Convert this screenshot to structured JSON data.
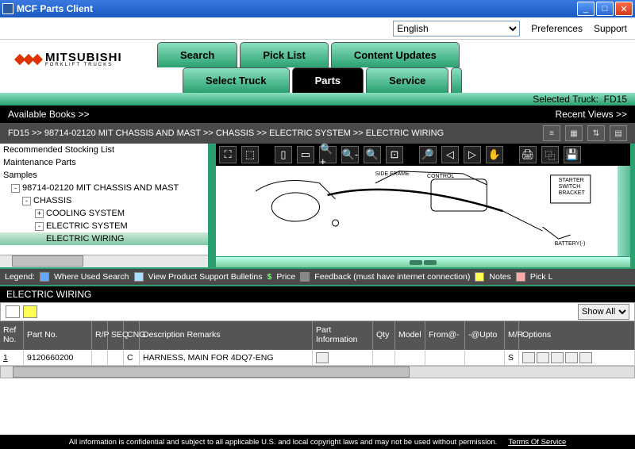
{
  "window": {
    "title": "MCF Parts Client"
  },
  "topbar": {
    "language": "English",
    "preferences": "Preferences",
    "support": "Support"
  },
  "logo": {
    "brand": "MITSUBISHI",
    "sub": "FORKLIFT TRUCKS"
  },
  "tabs_row1": [
    {
      "label": "Search"
    },
    {
      "label": "Pick List"
    },
    {
      "label": "Content Updates"
    }
  ],
  "tabs_row2": [
    {
      "label": "Select Truck"
    },
    {
      "label": "Parts",
      "active": true
    },
    {
      "label": "Service"
    }
  ],
  "selected_truck": {
    "label": "Selected Truck:",
    "value": "FD15"
  },
  "navbar": {
    "left": "Available Books >>",
    "right": "Recent Views >>"
  },
  "breadcrumb": "FD15 >> 98714-02120 MIT CHASSIS AND MAST >> CHASSIS >> ELECTRIC SYSTEM >> ELECTRIC WIRING",
  "tree": {
    "items": [
      {
        "label": "Recommended Stocking List",
        "indent": 0
      },
      {
        "label": "Maintenance Parts",
        "indent": 0
      },
      {
        "label": "Samples",
        "indent": 0
      },
      {
        "label": "98714-02120 MIT CHASSIS AND MAST",
        "indent": 0,
        "exp": "-"
      },
      {
        "label": "CHASSIS",
        "indent": 1,
        "exp": "-"
      },
      {
        "label": "COOLING SYSTEM",
        "indent": 2,
        "exp": "+"
      },
      {
        "label": "ELECTRIC SYSTEM",
        "indent": 2,
        "exp": "-"
      },
      {
        "label": "ELECTRIC WIRING",
        "indent": 3,
        "selected": true
      }
    ]
  },
  "legend": {
    "label": "Legend:",
    "where_used": "Where Used Search",
    "bulletins": "View Product Support Bulletins",
    "price": "Price",
    "feedback": "Feedback (must have internet connection)",
    "notes": "Notes",
    "pick": "Pick L"
  },
  "section_title": "ELECTRIC WIRING",
  "filter": {
    "show_all": "Show All"
  },
  "table": {
    "headers": {
      "ref": "Ref No.",
      "part": "Part No.",
      "rp": "R/P",
      "seq": "SEQ",
      "cng": "CNG",
      "desc": "Description\nRemarks",
      "pi": "Part Information",
      "qty": "Qty",
      "model": "Model",
      "from": "From@-",
      "upto": "-@Upto",
      "mr": "M/R",
      "opt": "Options"
    },
    "rows": [
      {
        "ref": "1",
        "part": "9120660200",
        "rp": "",
        "seq": "",
        "cng": "C",
        "desc": "HARNESS, MAIN FOR 4DQ7-ENG",
        "pi": "",
        "qty": "",
        "model": "",
        "from": "",
        "upto": "",
        "mr": "S"
      }
    ]
  },
  "footer": {
    "disclaimer": "All information is confidential and subject to all applicable U.S. and local copyright laws and may not be used without permission.",
    "tos": "Terms Of Service"
  }
}
